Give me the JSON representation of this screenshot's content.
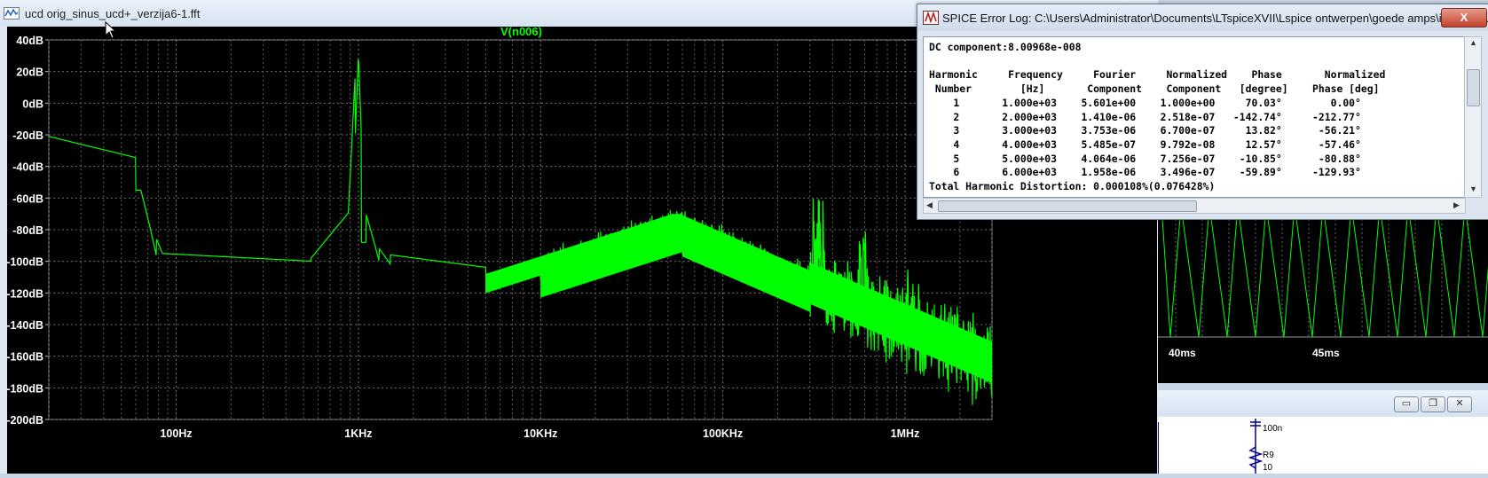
{
  "fft_window": {
    "title": "ucd orig_sinus_ucd+_verzija6-1.fft",
    "trace_label": "V(n006)",
    "trace_color": "#00ff00",
    "y_axis": [
      "40dB",
      "20dB",
      "0dB",
      "-20dB",
      "-40dB",
      "-60dB",
      "-80dB",
      "-100dB",
      "-120dB",
      "-140dB",
      "-160dB",
      "-180dB",
      "-200dB"
    ],
    "x_axis": [
      "100Hz",
      "1KHz",
      "10KHz",
      "100KHz",
      "1MHz"
    ]
  },
  "log_window": {
    "title": "SPICE Error Log: C:\\Users\\Administrator\\Documents\\LTspiceXVII\\Lspice ontwerpen\\goede amps\\ideal mo...",
    "close_label": "X",
    "dc_component": "DC component:8.00968e-008",
    "header1": "Harmonic     Frequency     Fourier     Normalized    Phase       Normalized",
    "header2": " Number        [Hz]       Component    Component   [degree]    Phase [deg]",
    "rows": [
      "    1       1.000e+03    5.601e+00    1.000e+00     70.03°        0.00°",
      "    2       2.000e+03    1.410e-06    2.518e-07   -142.74°     -212.77°",
      "    3       3.000e+03    3.753e-06    6.700e-07     13.82°      -56.21°",
      "    4       4.000e+03    5.485e-07    9.792e-08     12.57°      -57.46°",
      "    5       5.000e+03    4.064e-06    7.256e-07    -10.85°      -80.88°",
      "    6       6.000e+03    1.958e-06    3.496e-07    -59.89°     -129.93°"
    ],
    "thd": "Total Harmonic Distortion: 0.000108%(0.076428%)"
  },
  "tran_window": {
    "x_axis": [
      "40ms",
      "45ms"
    ]
  },
  "schem_window": {
    "labels": [
      "100n",
      "R9",
      "10"
    ]
  }
}
